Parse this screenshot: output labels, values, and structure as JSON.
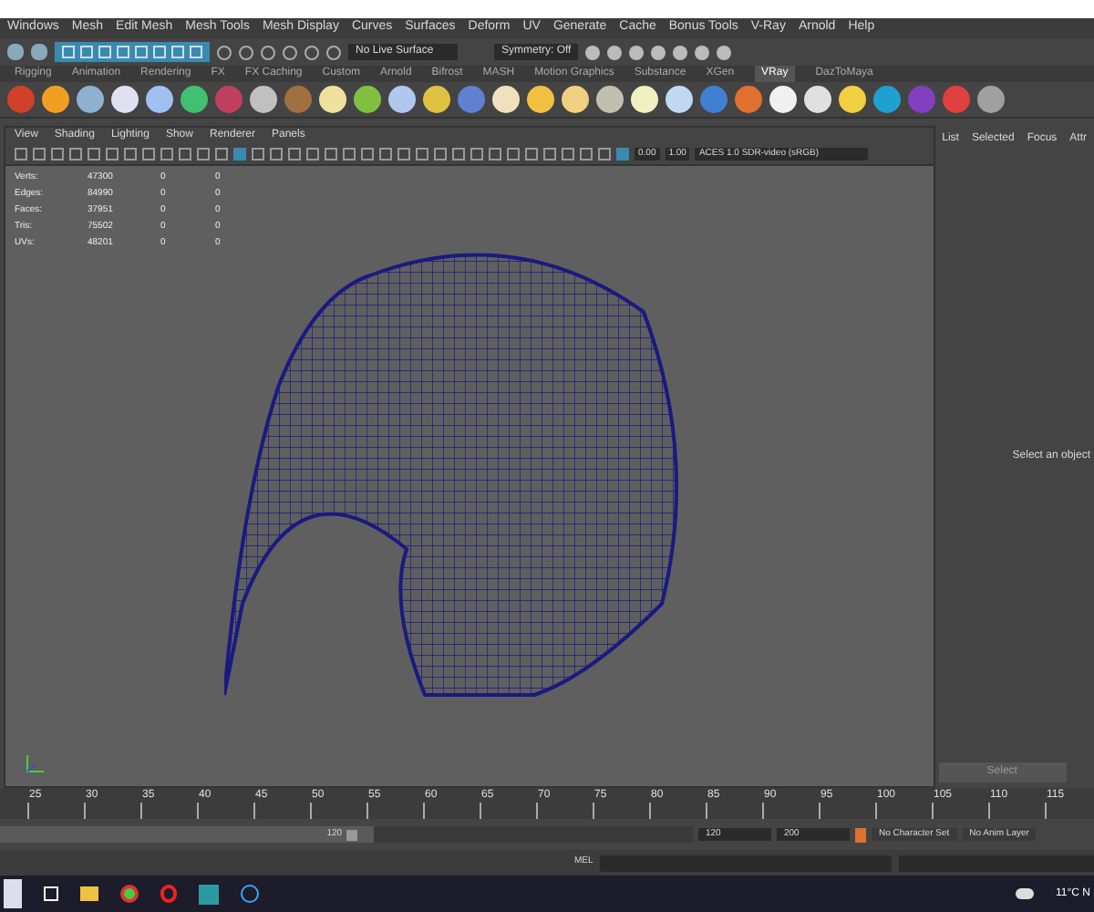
{
  "menu_bar": [
    "Windows",
    "Mesh",
    "Edit Mesh",
    "Mesh Tools",
    "Mesh Display",
    "Curves",
    "Surfaces",
    "Deform",
    "UV",
    "Generate",
    "Cache",
    "Bonus Tools",
    "V-Ray",
    "Arnold",
    "Help"
  ],
  "status_line": {
    "live_surface": "No Live Surface",
    "symmetry": "Symmetry: Off"
  },
  "shelf_tabs": [
    {
      "label": "Rigging",
      "selected": false
    },
    {
      "label": "Animation",
      "selected": false
    },
    {
      "label": "Rendering",
      "selected": false
    },
    {
      "label": "FX",
      "selected": false
    },
    {
      "label": "FX Caching",
      "selected": false
    },
    {
      "label": "Custom",
      "selected": false
    },
    {
      "label": "Arnold",
      "selected": false
    },
    {
      "label": "Bifrost",
      "selected": false
    },
    {
      "label": "MASH",
      "selected": false
    },
    {
      "label": "Motion Graphics",
      "selected": false
    },
    {
      "label": "Substance",
      "selected": false
    },
    {
      "label": "XGen",
      "selected": false
    },
    {
      "label": "VRay",
      "selected": true
    },
    {
      "label": "DazToMaya",
      "selected": false
    }
  ],
  "viewport": {
    "menu": [
      "View",
      "Shading",
      "Lighting",
      "Show",
      "Renderer",
      "Panels"
    ],
    "exposure": "0.00",
    "gamma": "1.00",
    "color_space": "ACES 1.0 SDR-video (sRGB)",
    "stats": [
      {
        "label": "Verts:",
        "values": [
          "47300",
          "0",
          "0"
        ]
      },
      {
        "label": "Edges:",
        "values": [
          "84990",
          "0",
          "0"
        ]
      },
      {
        "label": "Faces:",
        "values": [
          "37951",
          "0",
          "0"
        ]
      },
      {
        "label": "Tris:",
        "values": [
          "75502",
          "0",
          "0"
        ]
      },
      {
        "label": "UVs:",
        "values": [
          "48201",
          "0",
          "0"
        ]
      }
    ]
  },
  "attribute_editor": {
    "tabs": [
      "List",
      "Selected",
      "Focus",
      "Attr"
    ],
    "message": "Select an object",
    "button": "Select"
  },
  "time_slider": {
    "ticks": [
      "25",
      "30",
      "35",
      "40",
      "45",
      "50",
      "55",
      "60",
      "65",
      "70",
      "75",
      "80",
      "85",
      "90",
      "95",
      "100",
      "105",
      "110",
      "115"
    ]
  },
  "range_slider": {
    "level": 0.54,
    "slider_end": "120",
    "end_time": "120",
    "max_time": "200",
    "character_set": "No Character Set",
    "anim_layer": "No Anim Layer"
  },
  "command_line": {
    "label": "MEL"
  },
  "taskbar": {
    "weather": "11°C N"
  }
}
